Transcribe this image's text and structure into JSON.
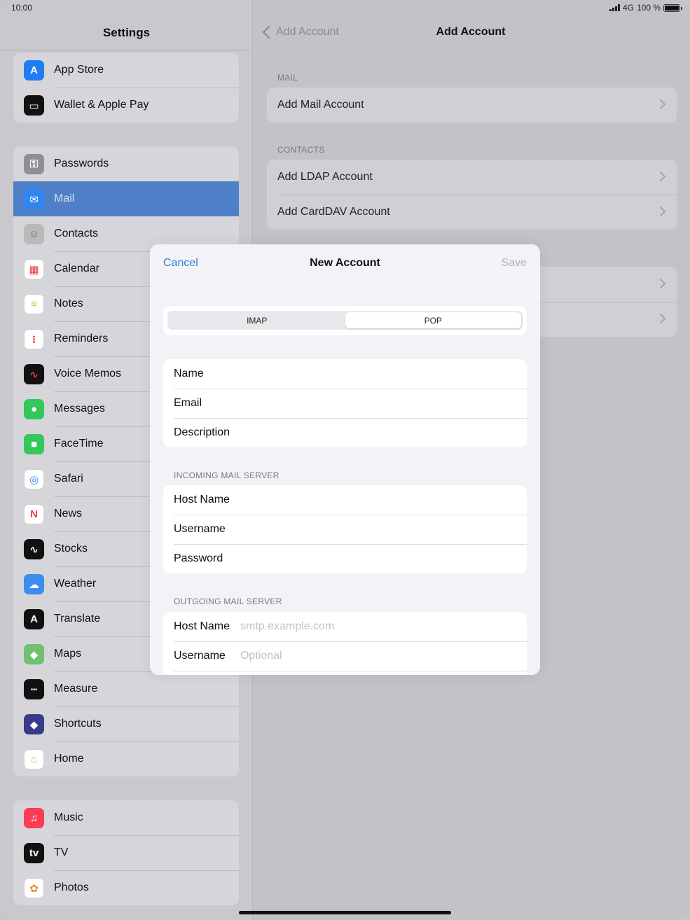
{
  "status": {
    "time": "10:00",
    "network": "4G",
    "battery": "100 %"
  },
  "sidebar": {
    "title": "Settings",
    "groups": [
      {
        "items": [
          {
            "label": "App Store",
            "icon": "app-store-icon",
            "color": "#1f7cf2"
          },
          {
            "label": "Wallet & Apple Pay",
            "icon": "wallet-icon",
            "color": "#111111"
          }
        ]
      },
      {
        "items": [
          {
            "label": "Passwords",
            "icon": "key-icon",
            "color": "#8e8e93"
          },
          {
            "label": "Mail",
            "icon": "mail-icon",
            "color": "#2f86f0",
            "selected": true
          },
          {
            "label": "Contacts",
            "icon": "contacts-icon",
            "color": "#b9b9b9"
          },
          {
            "label": "Calendar",
            "icon": "calendar-icon",
            "color": "#ffffff"
          },
          {
            "label": "Notes",
            "icon": "notes-icon",
            "color": "#ffffff"
          },
          {
            "label": "Reminders",
            "icon": "reminders-icon",
            "color": "#ffffff"
          },
          {
            "label": "Voice Memos",
            "icon": "voice-memos-icon",
            "color": "#111111"
          },
          {
            "label": "Messages",
            "icon": "messages-icon",
            "color": "#34c759"
          },
          {
            "label": "FaceTime",
            "icon": "facetime-icon",
            "color": "#34c759"
          },
          {
            "label": "Safari",
            "icon": "safari-icon",
            "color": "#ffffff"
          },
          {
            "label": "News",
            "icon": "news-icon",
            "color": "#ffffff"
          },
          {
            "label": "Stocks",
            "icon": "stocks-icon",
            "color": "#111111"
          },
          {
            "label": "Weather",
            "icon": "weather-icon",
            "color": "#3b8ef0"
          },
          {
            "label": "Translate",
            "icon": "translate-icon",
            "color": "#111111"
          },
          {
            "label": "Maps",
            "icon": "maps-icon",
            "color": "#6fc06f"
          },
          {
            "label": "Measure",
            "icon": "measure-icon",
            "color": "#111111"
          },
          {
            "label": "Shortcuts",
            "icon": "shortcuts-icon",
            "color": "#3a3a8c"
          },
          {
            "label": "Home",
            "icon": "home-icon",
            "color": "#ffffff"
          }
        ]
      },
      {
        "items": [
          {
            "label": "Music",
            "icon": "music-icon",
            "color": "#fa3c54"
          },
          {
            "label": "TV",
            "icon": "tv-icon",
            "color": "#111111"
          },
          {
            "label": "Photos",
            "icon": "photos-icon",
            "color": "#ffffff"
          }
        ]
      }
    ]
  },
  "detail": {
    "back_label": "Add Account",
    "title": "Add Account",
    "sections": [
      {
        "header": "MAIL",
        "items": [
          "Add Mail Account"
        ]
      },
      {
        "header": "CONTACTS",
        "items": [
          "Add LDAP Account",
          "Add CardDAV Account"
        ]
      }
    ]
  },
  "modal": {
    "cancel": "Cancel",
    "title": "New Account",
    "save": "Save",
    "segments": [
      "IMAP",
      "POP"
    ],
    "selected_segment": "POP",
    "account_fields": [
      "Name",
      "Email",
      "Description"
    ],
    "incoming_header": "INCOMING MAIL SERVER",
    "incoming_fields": [
      "Host Name",
      "Username",
      "Password"
    ],
    "outgoing_header": "OUTGOING MAIL SERVER",
    "outgoing_fields": [
      {
        "label": "Host Name",
        "placeholder": "smtp.example.com"
      },
      {
        "label": "Username",
        "placeholder": "Optional"
      }
    ]
  },
  "accent": "#2f80e0"
}
